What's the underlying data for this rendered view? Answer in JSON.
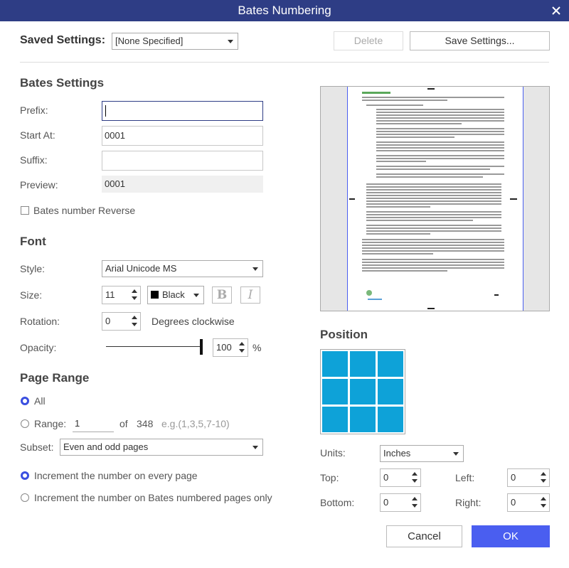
{
  "window": {
    "title": "Bates Numbering"
  },
  "saved_settings": {
    "label": "Saved Settings:",
    "value": "[None Specified]",
    "delete_label": "Delete",
    "save_label": "Save Settings..."
  },
  "bates": {
    "section": "Bates Settings",
    "prefix_label": "Prefix:",
    "prefix_value": "",
    "start_label": "Start At:",
    "start_value": "0001",
    "suffix_label": "Suffix:",
    "suffix_value": "",
    "preview_label": "Preview:",
    "preview_value": "0001",
    "reverse_label": "Bates number Reverse"
  },
  "font": {
    "section": "Font",
    "style_label": "Style:",
    "style_value": "Arial Unicode MS",
    "size_label": "Size:",
    "size_value": "11",
    "color_value": "Black",
    "color_hex": "#000000",
    "bold_glyph": "B",
    "italic_glyph": "I",
    "rotation_label": "Rotation:",
    "rotation_value": "0",
    "rotation_unit": "Degrees clockwise",
    "opacity_label": "Opacity:",
    "opacity_value": "100",
    "opacity_unit": "%",
    "opacity_fraction": 1.0
  },
  "page_range": {
    "section": "Page Range",
    "all_label": "All",
    "range_label": "Range:",
    "range_value": "1",
    "of_label": "of",
    "total_pages": "348",
    "range_hint": "e.g.(1,3,5,7-10)",
    "subset_label": "Subset:",
    "subset_value": "Even and odd pages",
    "increment_every": "Increment the number on every page",
    "increment_bates": "Increment the number on Bates numbered pages only"
  },
  "position": {
    "section": "Position",
    "units_label": "Units:",
    "units_value": "Inches",
    "top_label": "Top:",
    "top_value": "0",
    "left_label": "Left:",
    "left_value": "0",
    "bottom_label": "Bottom:",
    "bottom_value": "0",
    "right_label": "Right:",
    "right_value": "0"
  },
  "footer": {
    "cancel_label": "Cancel",
    "ok_label": "OK"
  },
  "colors": {
    "titlebar": "#2e3d85",
    "primary": "#4a5ef0",
    "grid_cell": "#0ea2d8"
  }
}
